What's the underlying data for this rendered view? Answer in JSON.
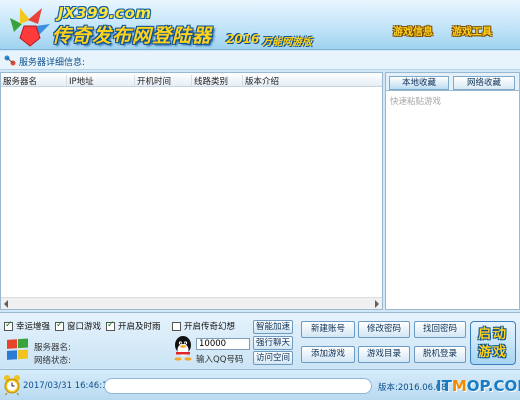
{
  "header": {
    "site_url": "JX399.com",
    "app_title": "传奇发布网登陆器",
    "year": "2016",
    "subtitle": "万能网游版",
    "links": {
      "news": "游戏信息",
      "tools": "游戏工具"
    }
  },
  "info_strip": {
    "label": "服务器详细信息:"
  },
  "server_list": {
    "columns": [
      "服务器名",
      "IP地址",
      "开机时间",
      "线路类别",
      "版本介绍"
    ],
    "rows": []
  },
  "favorites": {
    "tabs": {
      "local": "本地收藏",
      "network": "网络收藏"
    },
    "hint": "快速粘贴游戏"
  },
  "options": {
    "lucky_boost": {
      "label": "幸运增强",
      "checked": true
    },
    "window_game": {
      "label": "窗口游戏",
      "checked": true
    },
    "timely_rain": {
      "label": "开启及时雨",
      "checked": true
    },
    "legend_illusion": {
      "label": "开启传奇幻想",
      "checked": false
    }
  },
  "server_info": {
    "name_label": "服务器名:",
    "status_label": "网络状态:"
  },
  "qq": {
    "value": "10000",
    "label": "输入QQ号码"
  },
  "buttons": {
    "smart_accel": "智能加速",
    "force_chat": "强行聊天",
    "visit_space": "访问空间",
    "new_account": "新建账号",
    "change_password": "修改密码",
    "recover_password": "找回密码",
    "add_game": "添加游戏",
    "game_directory": "游戏目录",
    "offline_login": "脱机登录",
    "launch_game": "启动游戏"
  },
  "status": {
    "datetime": "2017/03/31 16:46:11",
    "version": "版本:2016.06.08"
  },
  "watermark": {
    "prefix": "IT",
    "mark": "M",
    "suffix": "OP.COM"
  },
  "colors": {
    "title_yellow": "#ffd21a",
    "outline_blue": "#0b4f96",
    "panel_blue": "#cfe7f7"
  }
}
